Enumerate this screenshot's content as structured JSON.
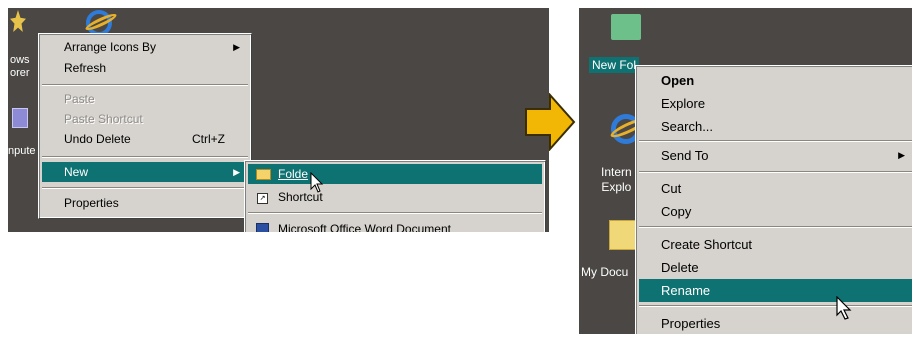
{
  "left": {
    "desktop_labels": [
      "ows",
      "orer",
      "npute"
    ],
    "context_menu": [
      {
        "label": "Arrange Icons By",
        "submenu": true
      },
      {
        "label": "Refresh"
      },
      {
        "label": "Paste",
        "disabled": true
      },
      {
        "label": "Paste Shortcut",
        "disabled": true
      },
      {
        "label": "Undo Delete",
        "accel": "Ctrl+Z"
      },
      {
        "label": "New",
        "submenu": true,
        "selected": true
      },
      {
        "label": "Properties"
      }
    ],
    "new_submenu": [
      {
        "label": "Folde",
        "selected": true
      },
      {
        "label": "Shortcut"
      },
      {
        "label": "Microsoft Office Word Document"
      }
    ]
  },
  "right": {
    "folder_label": "New Fol",
    "ie_label_1": "Intern",
    "ie_label_2": "Explo",
    "mydocs_label": "My Docu",
    "context_menu": [
      {
        "label": "Open",
        "bold": true
      },
      {
        "label": "Explore"
      },
      {
        "label": "Search..."
      },
      {
        "label": "Send To",
        "submenu": true
      },
      {
        "label": "Cut"
      },
      {
        "label": "Copy"
      },
      {
        "label": "Create Shortcut"
      },
      {
        "label": "Delete"
      },
      {
        "label": "Rename",
        "selected": true
      },
      {
        "label": "Properties"
      }
    ]
  },
  "colors": {
    "desktop": "#4a4744",
    "menu": "#d6d3ce",
    "highlight": "#0f7272",
    "arrow": "#f2b705"
  }
}
